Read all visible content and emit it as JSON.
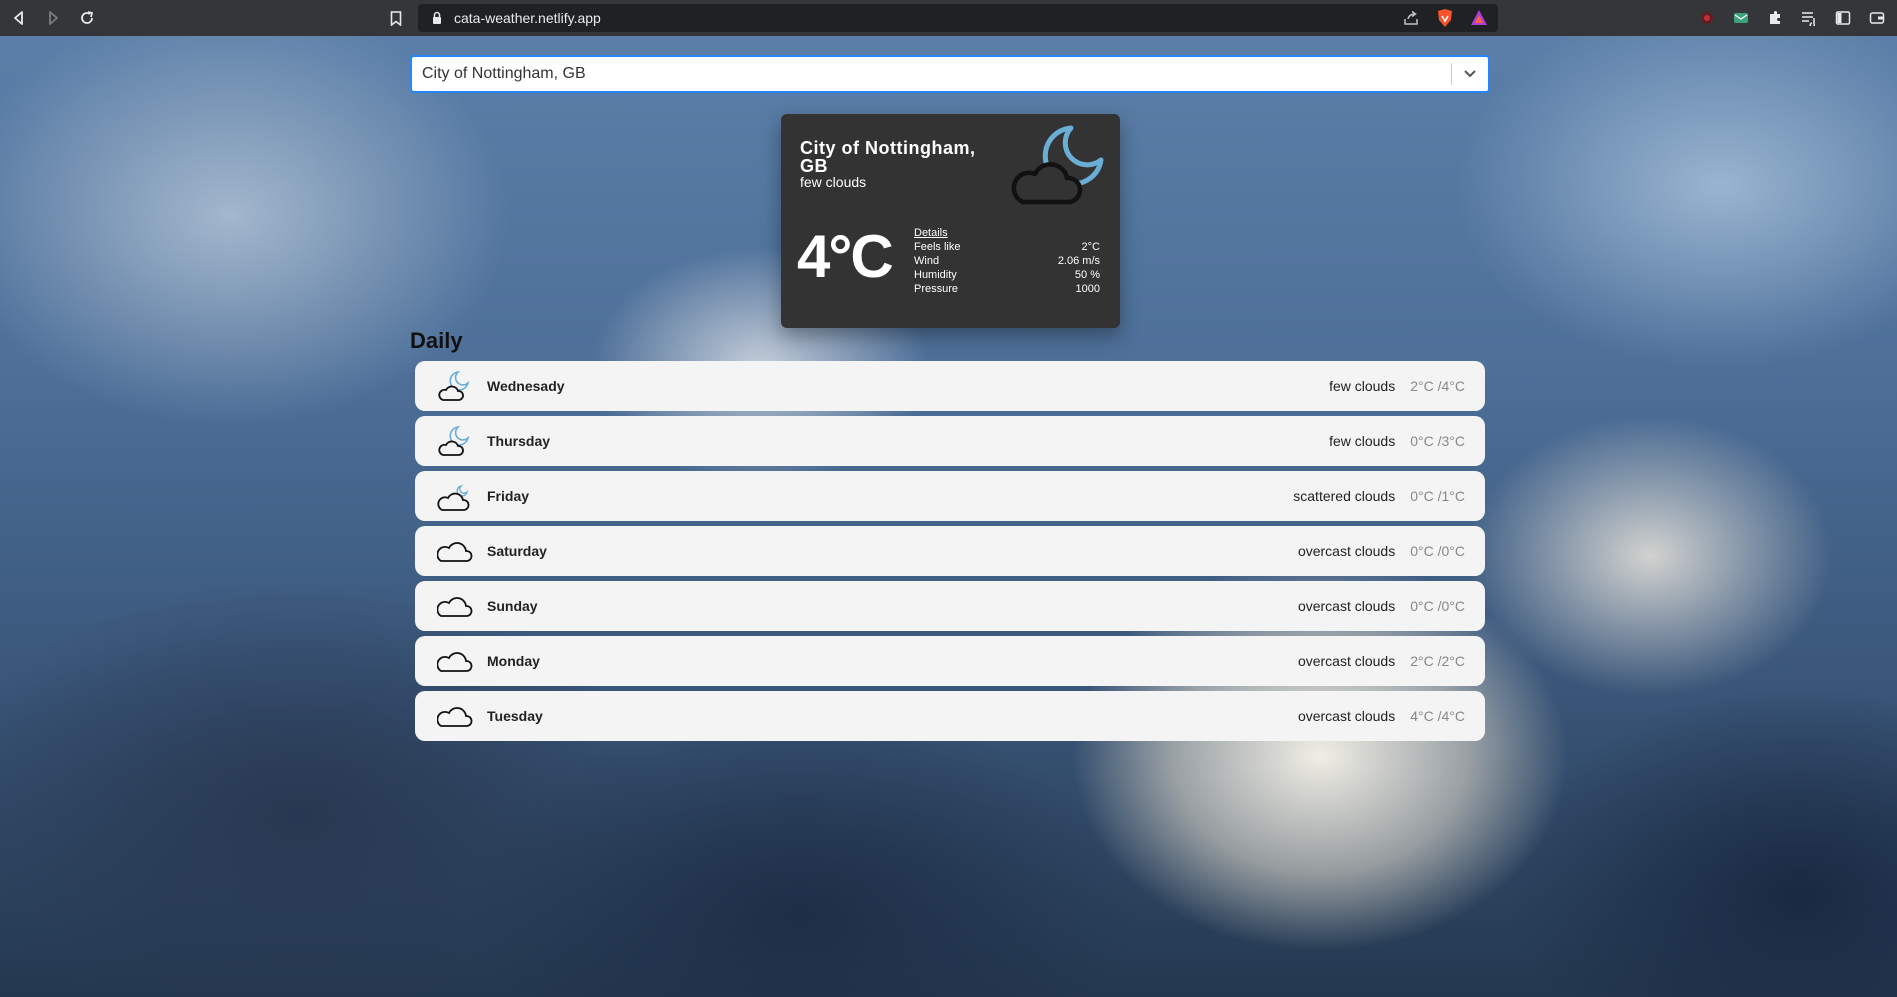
{
  "browser": {
    "url": "cata-weather.netlify.app"
  },
  "search": {
    "value": "City of Nottingham, GB"
  },
  "current": {
    "city": "City of Nottingham, GB",
    "description": "few clouds",
    "icon": "few-clouds-night-icon",
    "temperature": "4°C",
    "details_title": "Details",
    "details": [
      {
        "label": "Feels like",
        "value": "2°C"
      },
      {
        "label": "Wind",
        "value": "2.06 m/s"
      },
      {
        "label": "Humidity",
        "value": "50 %"
      },
      {
        "label": "Pressure",
        "value": "1000"
      }
    ]
  },
  "daily": {
    "title": "Daily",
    "days": [
      {
        "day": "Wednesady",
        "description": "few clouds",
        "temp": "2°C /4°C",
        "icon": "few-clouds-icon"
      },
      {
        "day": "Thursday",
        "description": "few clouds",
        "temp": "0°C /3°C",
        "icon": "few-clouds-icon"
      },
      {
        "day": "Friday",
        "description": "scattered clouds",
        "temp": "0°C /1°C",
        "icon": "scattered-clouds-icon"
      },
      {
        "day": "Saturday",
        "description": "overcast clouds",
        "temp": "0°C /0°C",
        "icon": "overcast-clouds-icon"
      },
      {
        "day": "Sunday",
        "description": "overcast clouds",
        "temp": "0°C /0°C",
        "icon": "overcast-clouds-icon"
      },
      {
        "day": "Monday",
        "description": "overcast clouds",
        "temp": "2°C /2°C",
        "icon": "overcast-clouds-icon"
      },
      {
        "day": "Tuesday",
        "description": "overcast clouds",
        "temp": "4°C /4°C",
        "icon": "overcast-clouds-icon"
      }
    ]
  },
  "colors": {
    "accent": "#2684ff",
    "card": "#333333",
    "moon": "#6aaed6"
  }
}
